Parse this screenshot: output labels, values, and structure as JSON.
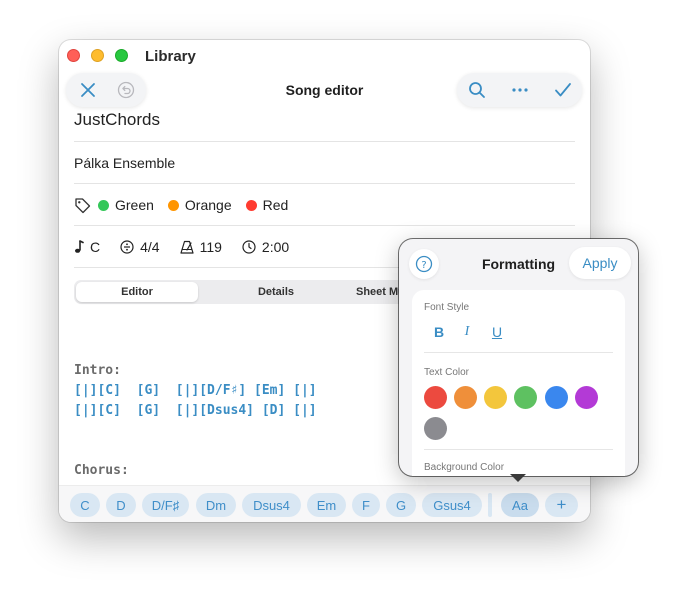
{
  "window": {
    "title": "Library"
  },
  "toolbar": {
    "title": "Song editor"
  },
  "song": {
    "title": "JustChords",
    "artist": "Pálka Ensemble",
    "tags": [
      {
        "label": "Green",
        "color": "#34c759"
      },
      {
        "label": "Orange",
        "color": "#ff9500"
      },
      {
        "label": "Red",
        "color": "#ff3b30"
      }
    ],
    "key": "C",
    "time_signature": "4/4",
    "tempo": "119",
    "duration": "2:00"
  },
  "segments": {
    "items": [
      "Editor",
      "Details",
      "Sheet Mu"
    ],
    "selected": "Editor"
  },
  "chord_sheet": {
    "intro_label": "Intro:",
    "intro_lines": [
      "[|][C]  [G]  [|][D/F♯] [Em] [|]",
      "[|][C]  [G]  [|][Dsus4] [D] [|]"
    ],
    "chorus_label": "Chorus:"
  },
  "chord_bar": {
    "chords": [
      "C",
      "D",
      "D/F♯",
      "Dm",
      "Dsus4",
      "Em",
      "F",
      "G",
      "Gsus4"
    ],
    "format_label": "Aa",
    "add_label": "+"
  },
  "formatting": {
    "title": "Formatting",
    "apply_label": "Apply",
    "font_style_label": "Font Style",
    "bold_label": "B",
    "italic_label": "I",
    "underline_label": "U",
    "text_color_label": "Text Color",
    "text_colors": [
      "#ec4a3f",
      "#ef8f3a",
      "#f3c63c",
      "#5ec161",
      "#3a87ee",
      "#b33ad6",
      "#8b8b90"
    ],
    "background_color_label": "Background Color"
  },
  "colors": {
    "accent": "#3a8dc4"
  }
}
